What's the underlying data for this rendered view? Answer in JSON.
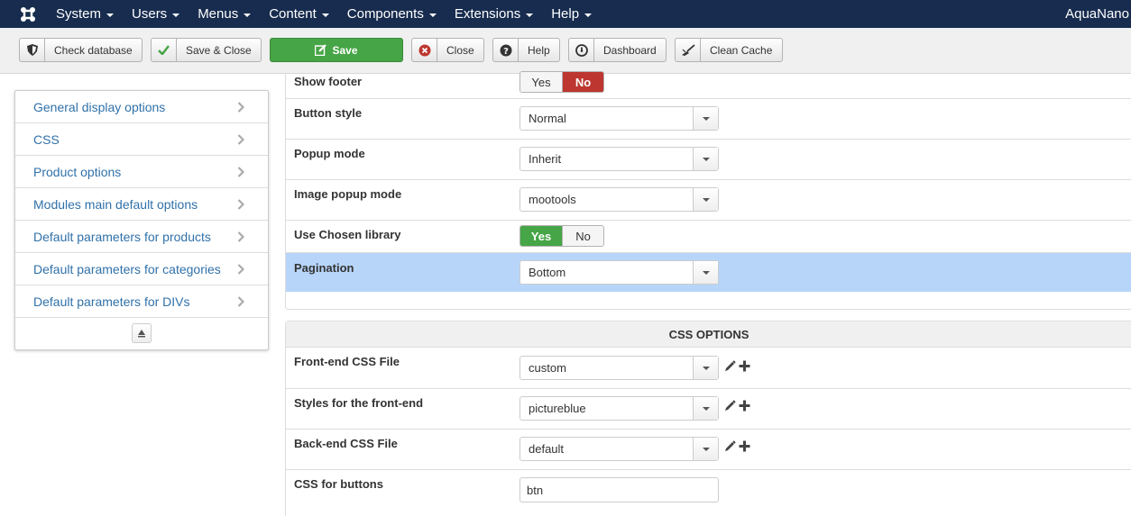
{
  "navbar": {
    "logo_icon": "joomla-logo-icon",
    "menus": [
      {
        "label": "System"
      },
      {
        "label": "Users"
      },
      {
        "label": "Menus"
      },
      {
        "label": "Content"
      },
      {
        "label": "Components"
      },
      {
        "label": "Extensions"
      },
      {
        "label": "Help"
      }
    ],
    "site_name": "AquaNano"
  },
  "toolbar": {
    "check_database": "Check database",
    "save_close": "Save & Close",
    "save": "Save",
    "close": "Close",
    "help": "Help",
    "dashboard": "Dashboard",
    "clean_cache": "Clean Cache",
    "save_color": "#46a546"
  },
  "sidebar": {
    "items": [
      {
        "label": "General display options"
      },
      {
        "label": "CSS"
      },
      {
        "label": "Product options"
      },
      {
        "label": "Modules main default options"
      },
      {
        "label": "Default parameters for products"
      },
      {
        "label": "Default parameters for categories"
      },
      {
        "label": "Default parameters for DIVs"
      }
    ],
    "link_color": "#3071a9"
  },
  "display_options": {
    "show_footer": {
      "label": "Show footer",
      "yes": "Yes",
      "no": "No",
      "selected": "No"
    },
    "button_style": {
      "label": "Button style",
      "value": "Normal"
    },
    "popup_mode": {
      "label": "Popup mode",
      "value": "Inherit"
    },
    "image_popup_mode": {
      "label": "Image popup mode",
      "value": "mootools"
    },
    "use_chosen": {
      "label": "Use Chosen library",
      "yes": "Yes",
      "no": "No",
      "selected": "Yes"
    },
    "pagination": {
      "label": "Pagination",
      "value": "Bottom"
    }
  },
  "css_options": {
    "header": "CSS OPTIONS",
    "frontend_css": {
      "label": "Front-end CSS File",
      "value": "custom"
    },
    "frontend_styles": {
      "label": "Styles for the front-end",
      "value": "pictureblue"
    },
    "backend_css": {
      "label": "Back-end CSS File",
      "value": "default"
    },
    "css_buttons": {
      "label": "CSS for buttons",
      "value": "btn"
    }
  },
  "colors": {
    "navbar_bg": "#172c4e",
    "no_active": "#bd362f",
    "yes_active": "#46a546",
    "highlight_row": "#b7d5f9"
  }
}
